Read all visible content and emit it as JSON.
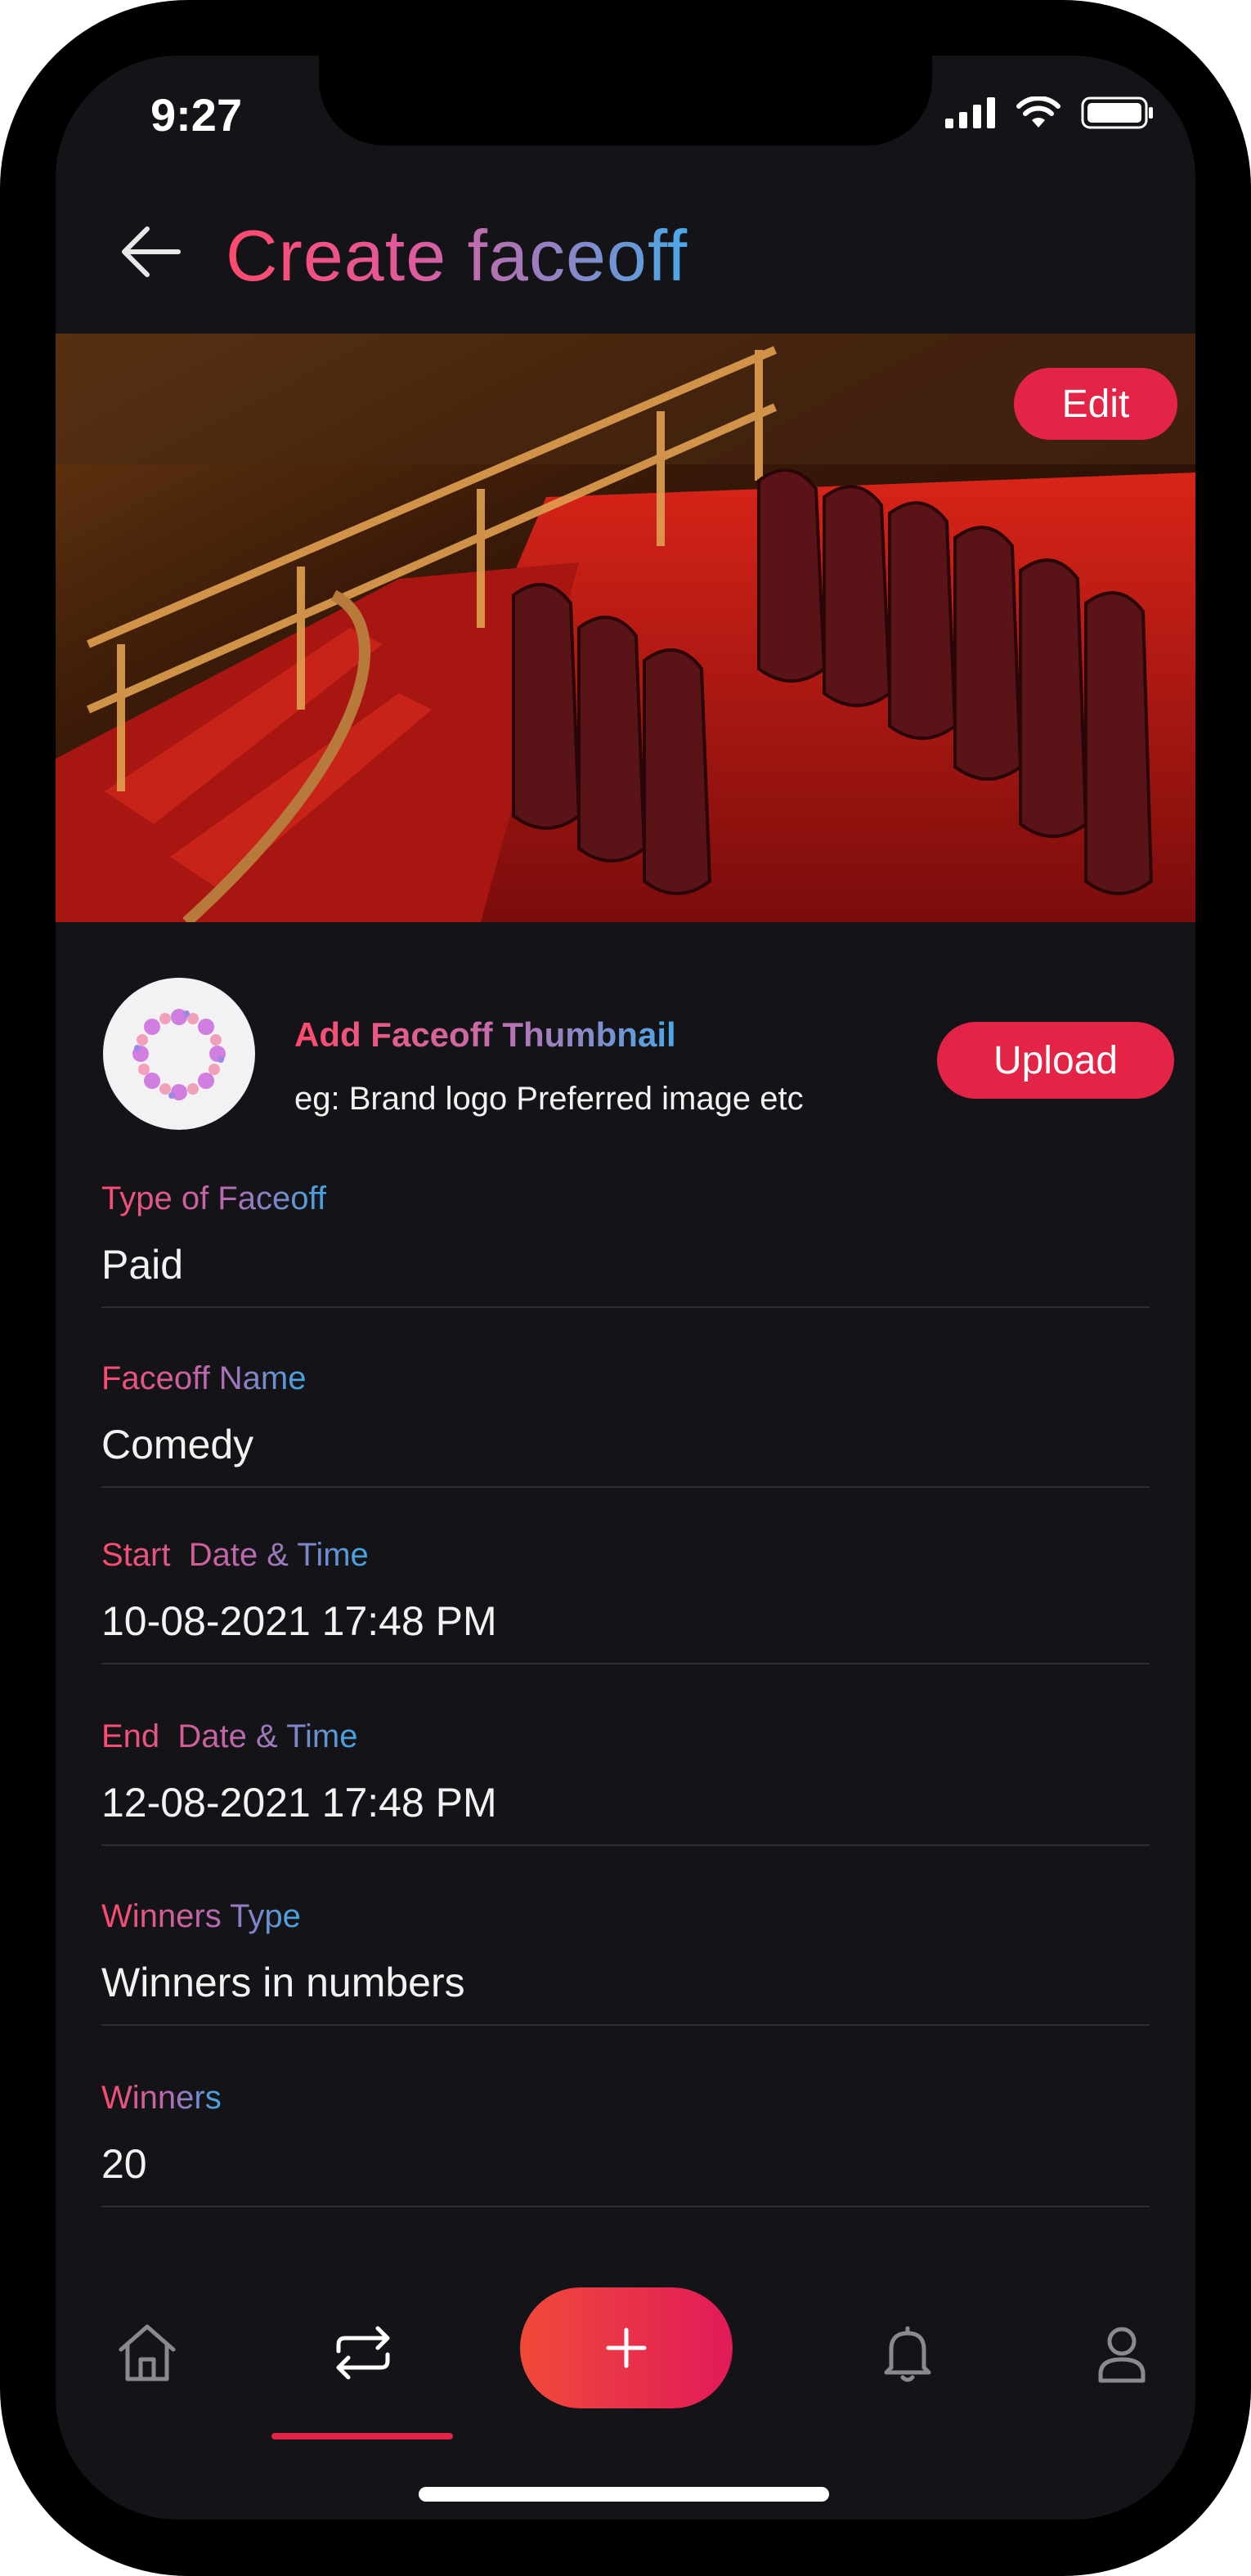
{
  "status_bar": {
    "time": "9:27"
  },
  "header": {
    "title": "Create faceoff"
  },
  "banner": {
    "edit_label": "Edit"
  },
  "thumbnail": {
    "title": "Add Faceoff Thumbnail",
    "subtitle": "eg: Brand logo Preferred image etc",
    "upload_label": "Upload"
  },
  "fields": [
    {
      "label": "Type of Faceoff",
      "value": "Paid"
    },
    {
      "label": "Faceoff Name",
      "value": "Comedy"
    },
    {
      "label": "Start  Date & Time",
      "value": "10-08-2021 17:48 PM"
    },
    {
      "label": "End  Date & Time",
      "value": "12-08-2021 17:48 PM"
    },
    {
      "label": "Winners Type",
      "value": "Winners in numbers"
    },
    {
      "label": "Winners",
      "value": "20"
    }
  ],
  "bottom_nav": {
    "items": [
      "home-icon",
      "swap-icon",
      "plus-icon",
      "bell-icon",
      "user-icon"
    ],
    "active": "swap-icon"
  },
  "colors": {
    "background": "#141418",
    "accent": "#e32446",
    "gradient_pink": "#ff4a6c",
    "gradient_blue": "#4aa8e6"
  }
}
